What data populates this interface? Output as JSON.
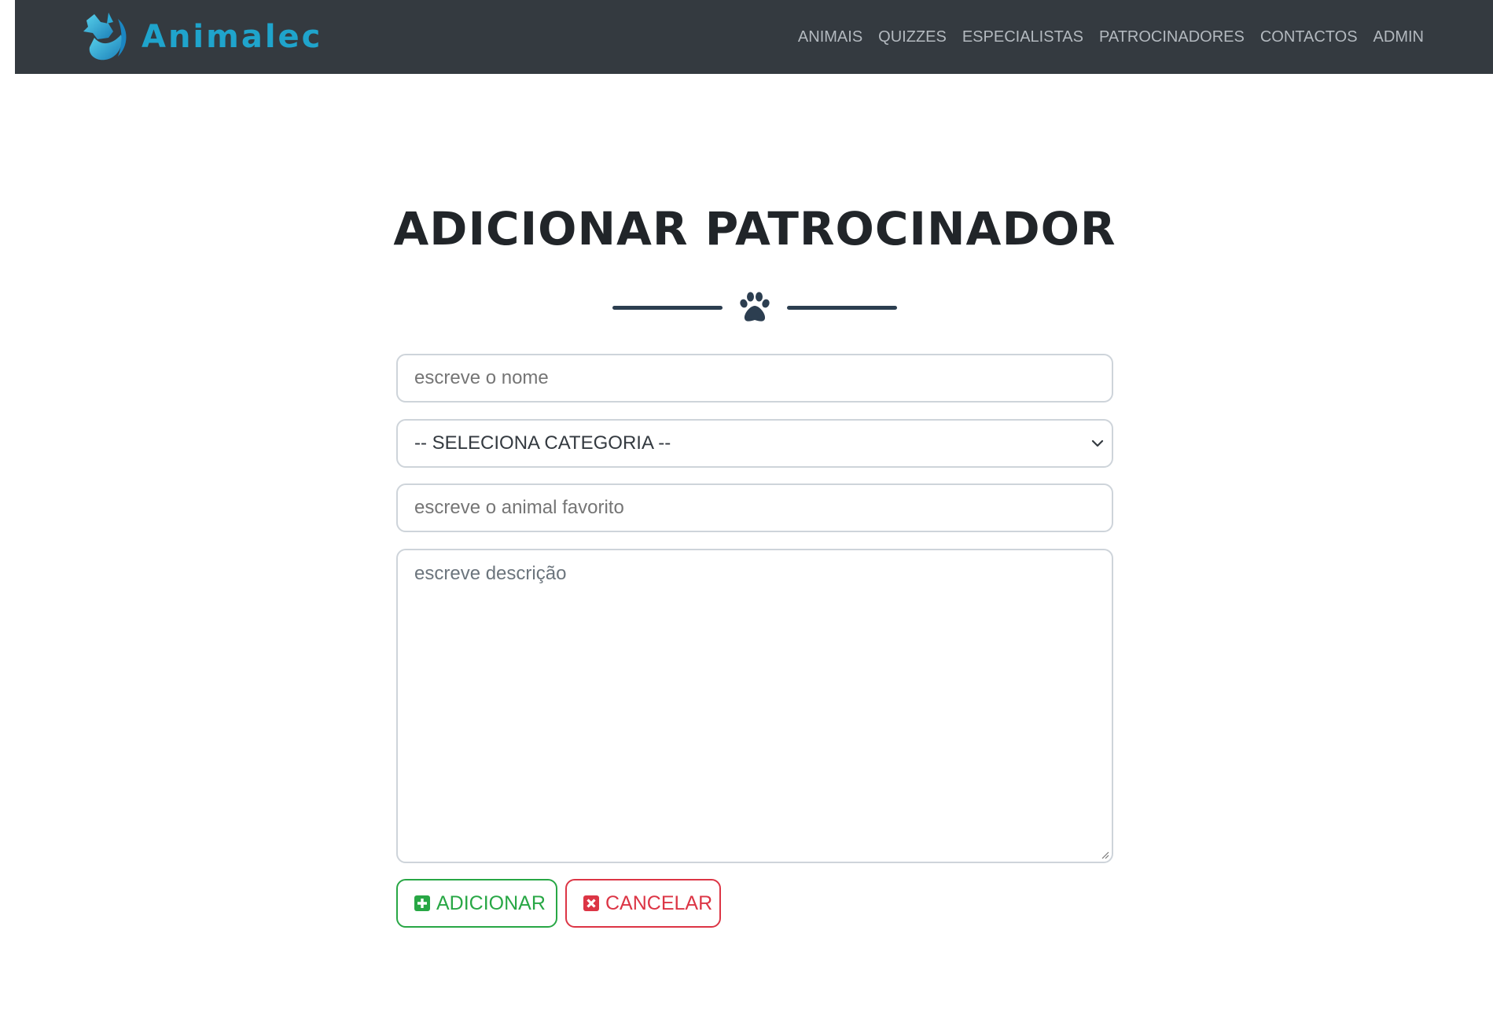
{
  "brand": {
    "name": "Animalec",
    "logo_icon": "fox-logo-icon",
    "color": "#1fa4cc"
  },
  "nav": {
    "items": [
      {
        "label": "ANIMAIS"
      },
      {
        "label": "QUIZZES"
      },
      {
        "label": "ESPECIALISTAS"
      },
      {
        "label": "PATROCINADORES"
      },
      {
        "label": "CONTACTOS"
      },
      {
        "label": "ADMIN"
      }
    ],
    "background": "#343a40",
    "link_color": "#b3b9bf"
  },
  "page": {
    "title": "ADICIONAR PATROCINADOR",
    "divider_icon": "paw-icon"
  },
  "form": {
    "name_placeholder": "escreve o nome",
    "name_value": "",
    "category_selected": "-- SELECIONA CATEGORIA --",
    "animal_placeholder": "escreve o animal favorito",
    "animal_value": "",
    "description_placeholder": "escreve descrição",
    "description_value": ""
  },
  "buttons": {
    "add_label": "ADICIONAR",
    "add_icon": "plus-square-icon",
    "add_color": "#28a745",
    "cancel_label": "CANCELAR",
    "cancel_icon": "close-square-icon",
    "cancel_color": "#dc3545"
  }
}
